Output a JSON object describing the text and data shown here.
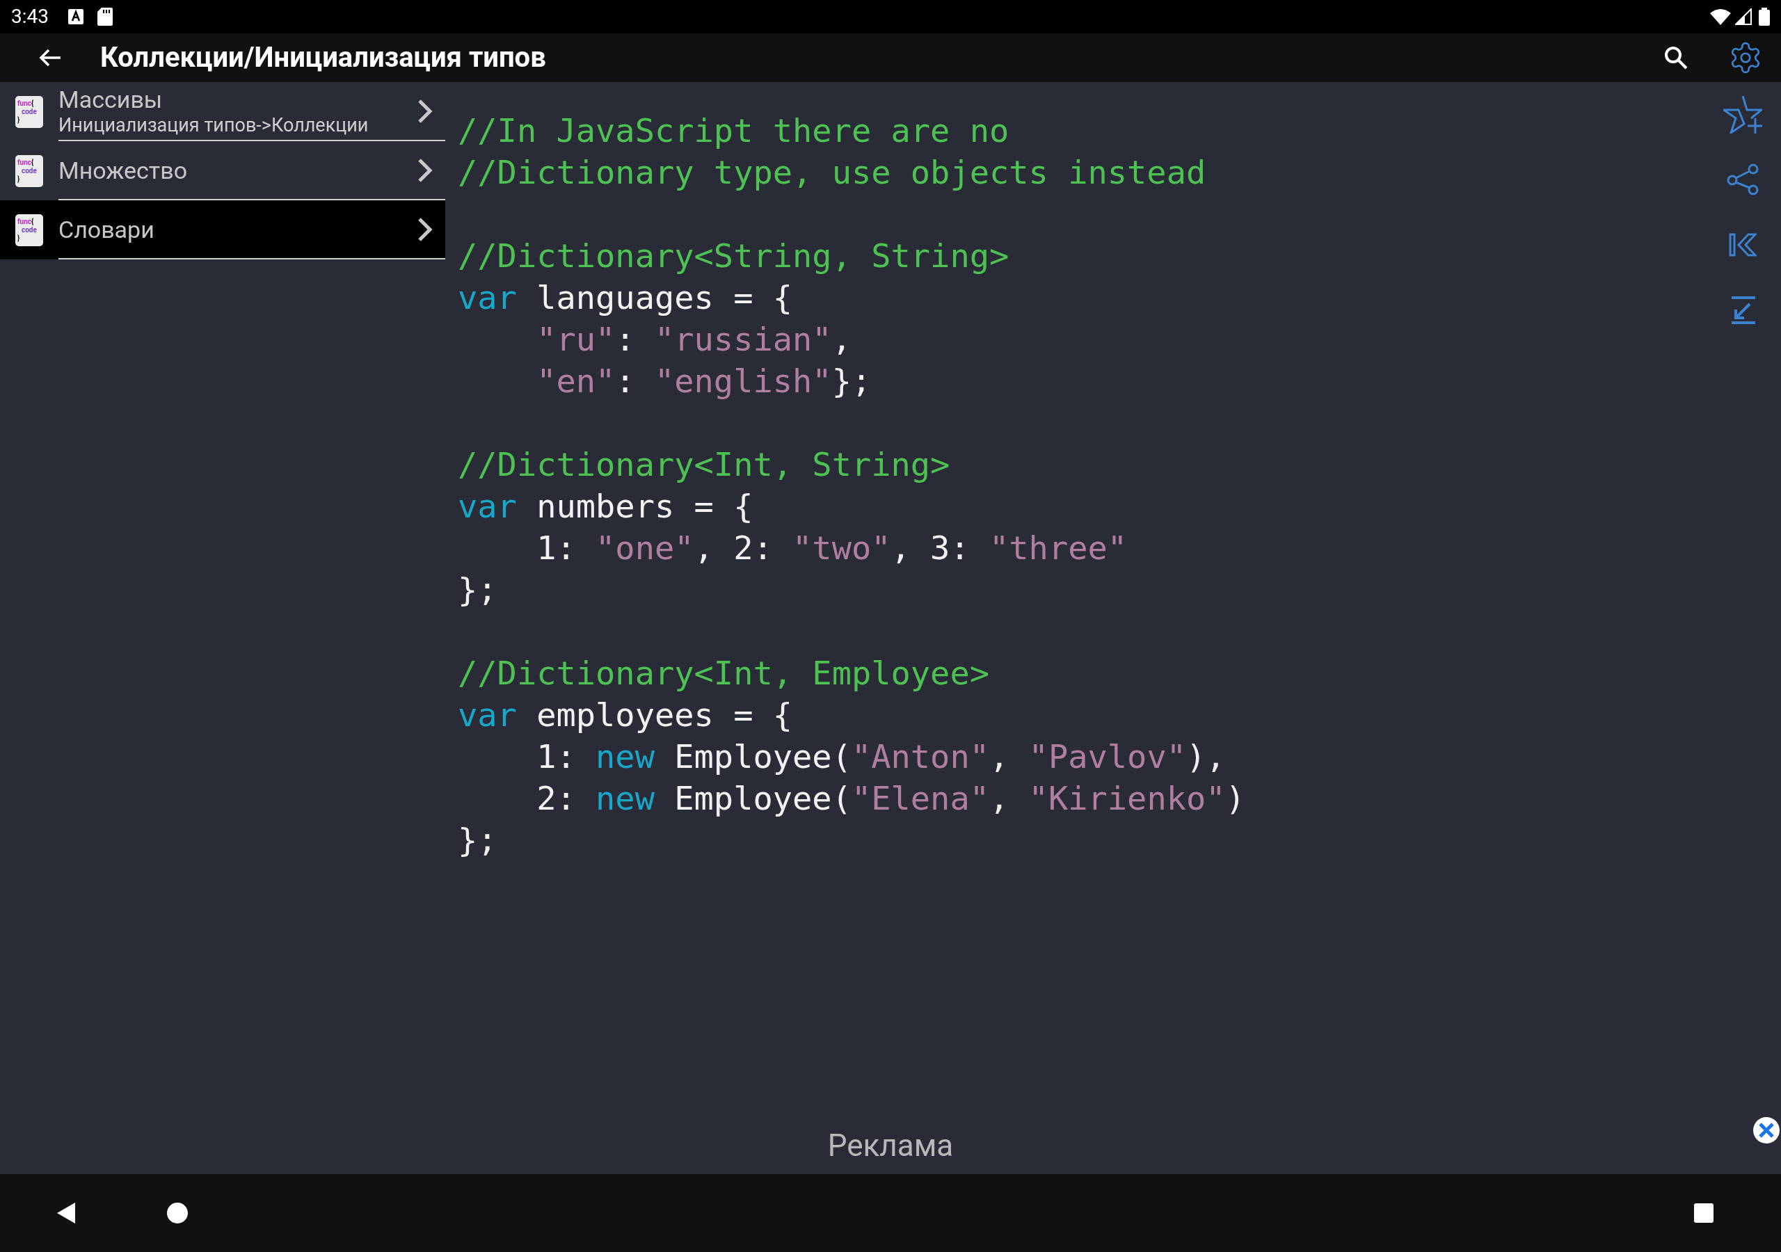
{
  "status_bar": {
    "time": "3:43"
  },
  "toolbar": {
    "title": "Коллекции/Инициализация типов"
  },
  "sidebar": {
    "items": [
      {
        "icon": [
          "func",
          "{",
          "code",
          "}"
        ],
        "title": "Массивы",
        "subtitle": "Инициализация типов->Коллекции",
        "selected": false
      },
      {
        "icon": [
          "func",
          "{",
          "code",
          "}"
        ],
        "title": "Множество",
        "selected": false
      },
      {
        "icon": [
          "func",
          "{",
          "code",
          "}"
        ],
        "title": "Словари",
        "selected": true
      }
    ]
  },
  "code": {
    "lines": [
      {
        "kind": "code",
        "tokens": [
          {
            "kind": "comment",
            "text": "//In JavaScript there are no"
          }
        ]
      },
      {
        "kind": "code",
        "tokens": [
          {
            "kind": "comment",
            "text": "//Dictionary type, use objects instead"
          }
        ]
      },
      {
        "kind": "blank"
      },
      {
        "kind": "code",
        "tokens": [
          {
            "kind": "comment",
            "text": "//Dictionary<String, String>"
          }
        ]
      },
      {
        "kind": "code",
        "tokens": [
          {
            "kind": "keyword",
            "text": "var"
          },
          {
            "kind": "plain",
            "text": " languages = {"
          }
        ]
      },
      {
        "kind": "code",
        "tokens": [
          {
            "kind": "string",
            "text": "    \"ru\""
          },
          {
            "kind": "plain",
            "text": ": "
          },
          {
            "kind": "string",
            "text": "\"russian\""
          },
          {
            "kind": "plain",
            "text": ","
          }
        ]
      },
      {
        "kind": "code",
        "tokens": [
          {
            "kind": "string",
            "text": "    \"en\""
          },
          {
            "kind": "plain",
            "text": ": "
          },
          {
            "kind": "string",
            "text": "\"english\""
          },
          {
            "kind": "plain",
            "text": "};"
          }
        ]
      },
      {
        "kind": "blank"
      },
      {
        "kind": "code",
        "tokens": [
          {
            "kind": "comment",
            "text": "//Dictionary<Int, String>"
          }
        ]
      },
      {
        "kind": "code",
        "tokens": [
          {
            "kind": "keyword",
            "text": "var"
          },
          {
            "kind": "plain",
            "text": " numbers = {"
          }
        ]
      },
      {
        "kind": "code",
        "tokens": [
          {
            "kind": "plain",
            "text": "    1: "
          },
          {
            "kind": "string",
            "text": "\"one\""
          },
          {
            "kind": "plain",
            "text": ", 2: "
          },
          {
            "kind": "string",
            "text": "\"two\""
          },
          {
            "kind": "plain",
            "text": ", 3: "
          },
          {
            "kind": "string",
            "text": "\"three\""
          }
        ]
      },
      {
        "kind": "code",
        "tokens": [
          {
            "kind": "plain",
            "text": "};"
          }
        ]
      },
      {
        "kind": "blank"
      },
      {
        "kind": "code",
        "tokens": [
          {
            "kind": "comment",
            "text": "//Dictionary<Int, Employee>"
          }
        ]
      },
      {
        "kind": "code",
        "tokens": [
          {
            "kind": "keyword",
            "text": "var"
          },
          {
            "kind": "plain",
            "text": " employees = {"
          }
        ]
      },
      {
        "kind": "code",
        "tokens": [
          {
            "kind": "plain",
            "text": "    1: "
          },
          {
            "kind": "keyword",
            "text": "new"
          },
          {
            "kind": "plain",
            "text": " Employee("
          },
          {
            "kind": "string",
            "text": "\"Anton\""
          },
          {
            "kind": "plain",
            "text": ", "
          },
          {
            "kind": "string",
            "text": "\"Pavlov\""
          },
          {
            "kind": "plain",
            "text": "),"
          }
        ]
      },
      {
        "kind": "code",
        "tokens": [
          {
            "kind": "plain",
            "text": "    2: "
          },
          {
            "kind": "keyword",
            "text": "new"
          },
          {
            "kind": "plain",
            "text": " Employee("
          },
          {
            "kind": "string",
            "text": "\"Elena\""
          },
          {
            "kind": "plain",
            "text": ", "
          },
          {
            "kind": "string",
            "text": "\"Kirienko\""
          },
          {
            "kind": "plain",
            "text": ")"
          }
        ]
      },
      {
        "kind": "code",
        "tokens": [
          {
            "kind": "plain",
            "text": "};"
          }
        ]
      }
    ]
  },
  "ad": {
    "label": "Реклама"
  }
}
